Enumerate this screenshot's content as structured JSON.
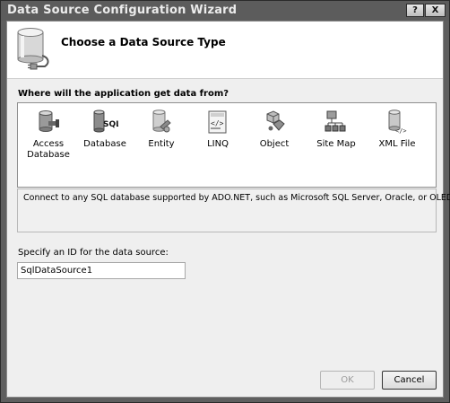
{
  "window": {
    "title": "Data Source Configuration Wizard",
    "help_glyph": "?",
    "close_glyph": "X"
  },
  "header": {
    "title": "Choose a Data Source Type"
  },
  "question": "Where will the application get data from?",
  "sources": [
    {
      "label": "Access\nDatabase",
      "icon": "access-database-icon"
    },
    {
      "label": "Database",
      "icon": "sql-database-icon"
    },
    {
      "label": "Entity",
      "icon": "entity-icon"
    },
    {
      "label": "LINQ",
      "icon": "linq-icon"
    },
    {
      "label": "Object",
      "icon": "object-icon"
    },
    {
      "label": "Site Map",
      "icon": "site-map-icon"
    },
    {
      "label": "XML File",
      "icon": "xml-file-icon"
    }
  ],
  "description": "Connect to any SQL database supported by ADO.NET, such as Microsoft SQL Server, Oracle, or OLEDB.",
  "id_field": {
    "label": "Specify an ID for the data source:",
    "value": "SqlDataSource1"
  },
  "buttons": {
    "ok": "OK",
    "cancel": "Cancel"
  }
}
